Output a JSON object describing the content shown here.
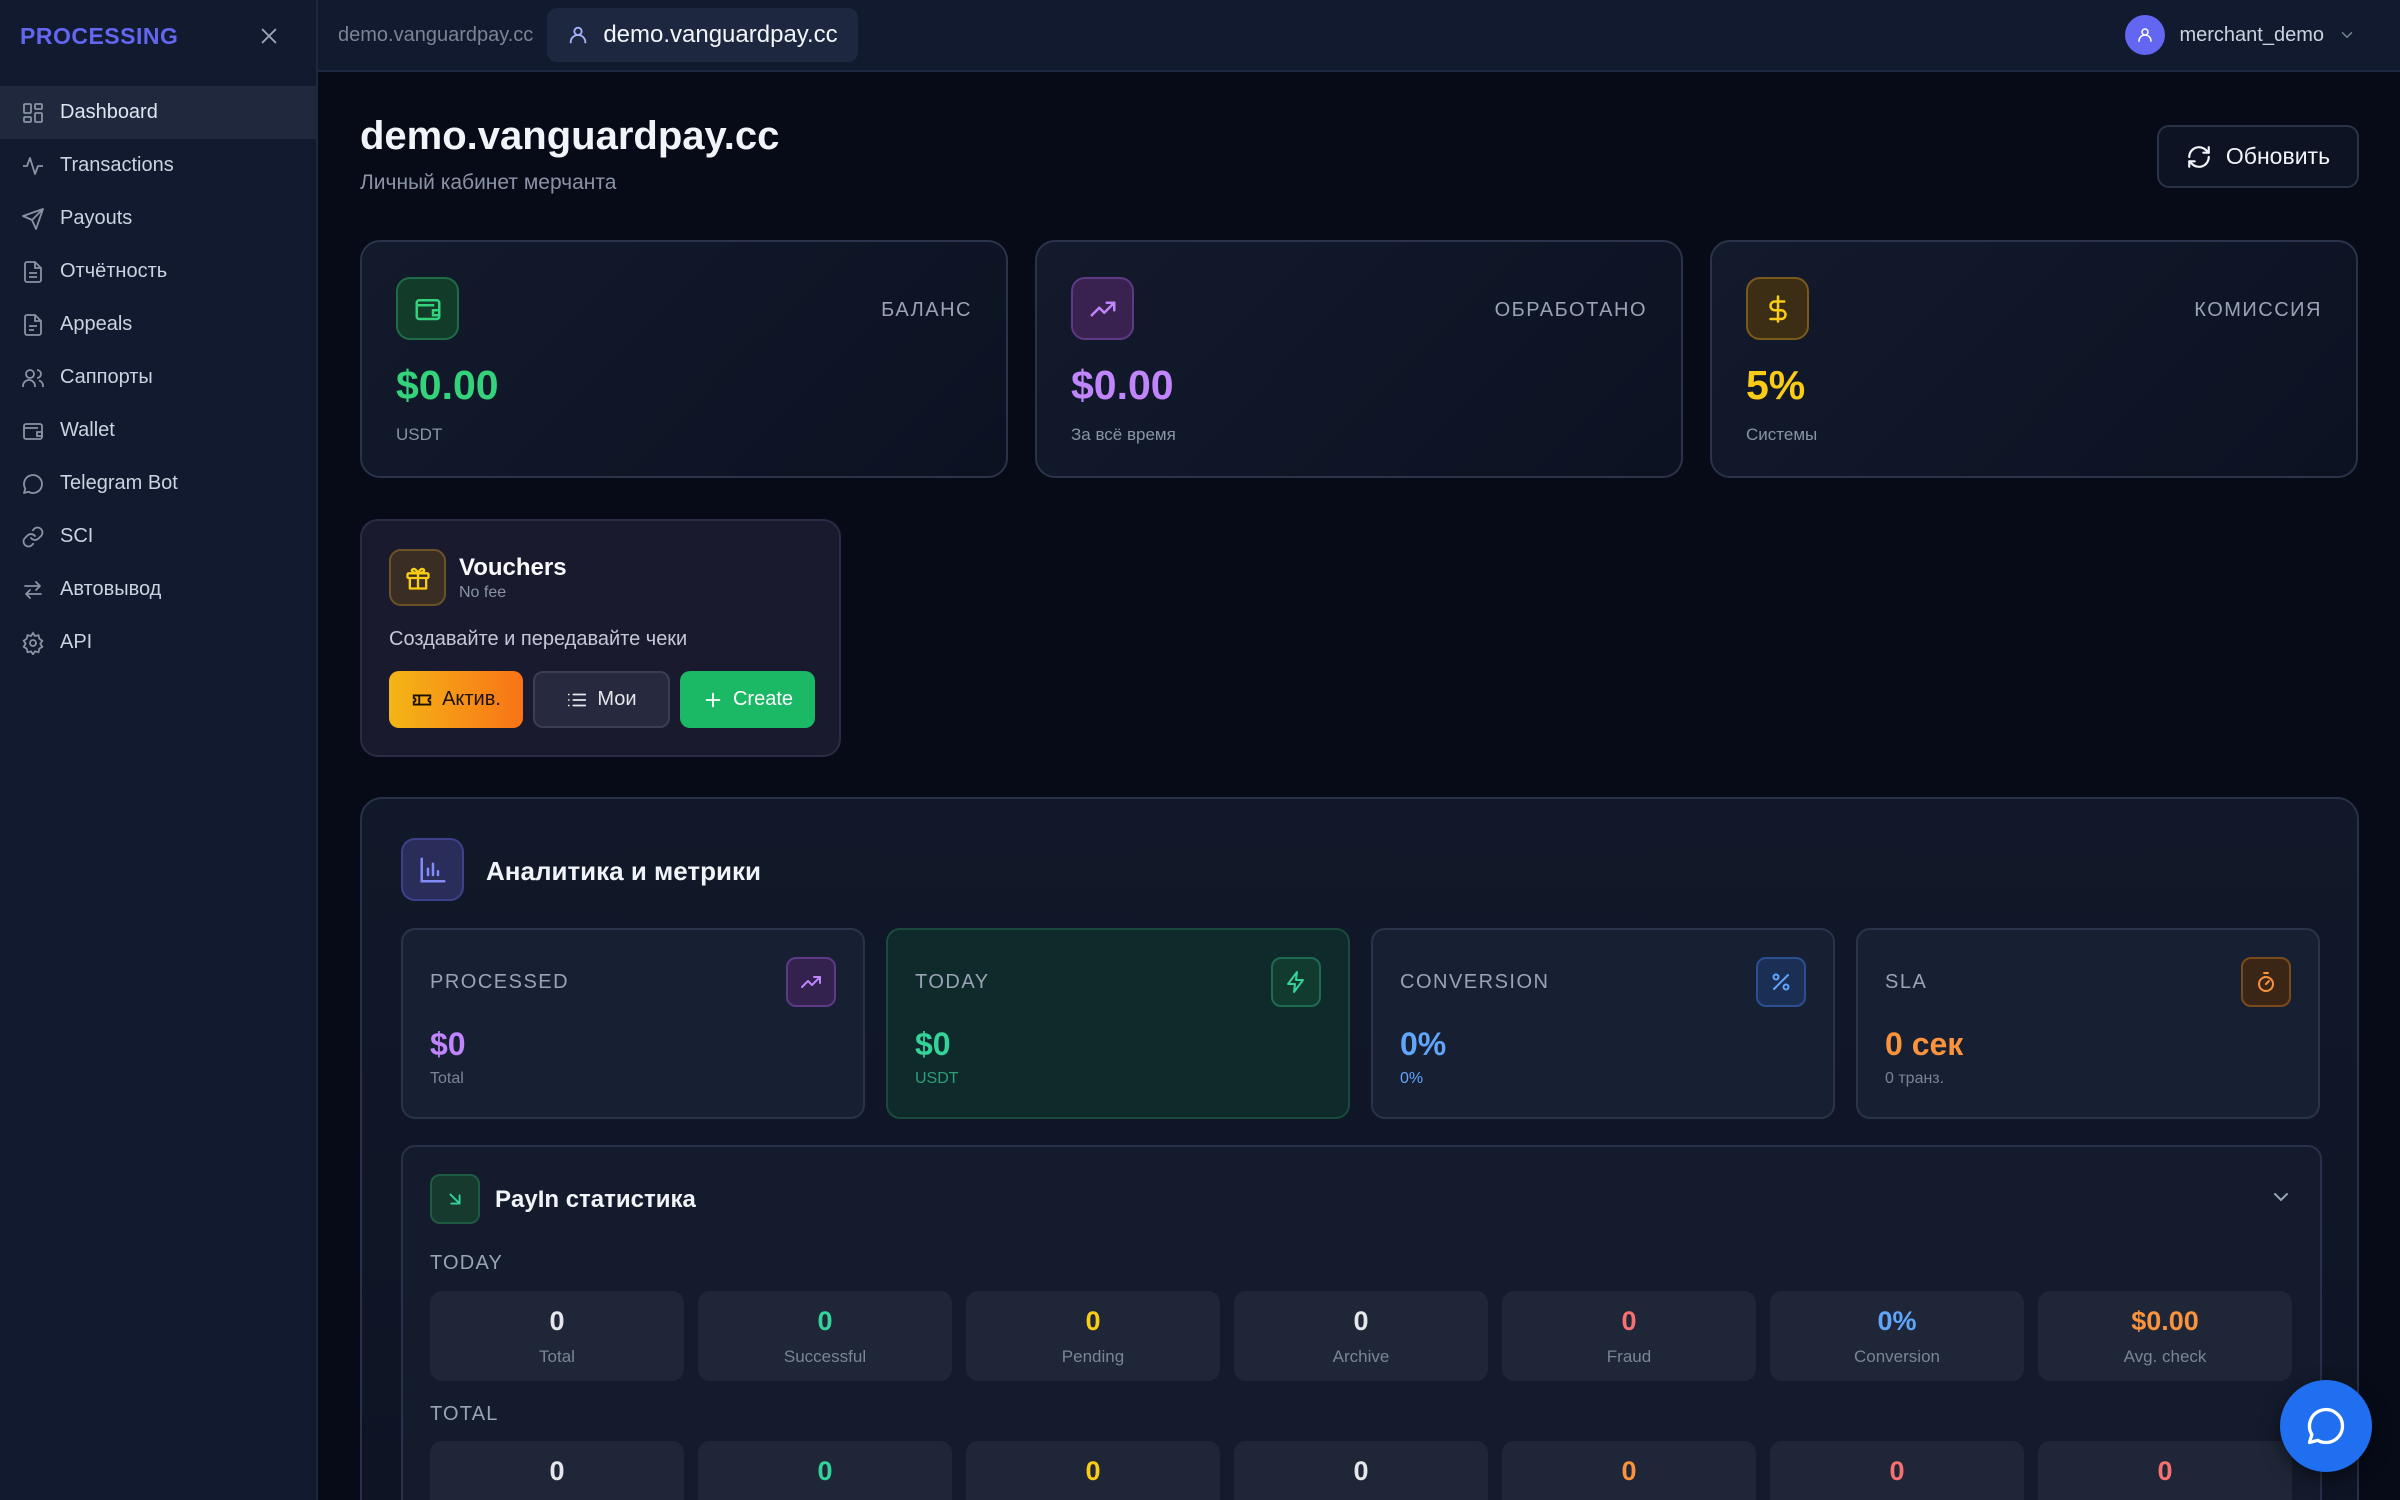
{
  "sidebar": {
    "brand": "PROCESSING",
    "items": [
      {
        "label": "Dashboard",
        "icon": "dashboard-icon"
      },
      {
        "label": "Transactions",
        "icon": "activity-icon"
      },
      {
        "label": "Payouts",
        "icon": "send-icon"
      },
      {
        "label": "Отчётность",
        "icon": "report-icon"
      },
      {
        "label": "Appeals",
        "icon": "document-icon"
      },
      {
        "label": "Саппорты",
        "icon": "users-icon"
      },
      {
        "label": "Wallet",
        "icon": "wallet-icon"
      },
      {
        "label": "Telegram Bot",
        "icon": "chat-icon"
      },
      {
        "label": "SCI",
        "icon": "link-icon"
      },
      {
        "label": "Автовывод",
        "icon": "transfer-icon"
      },
      {
        "label": "API",
        "icon": "gear-icon"
      }
    ]
  },
  "topbar": {
    "breadcrumb": "demo.vanguardpay.cc",
    "domain": "demo.vanguardpay.cc",
    "user": "merchant_demo"
  },
  "header": {
    "title": "demo.vanguardpay.cc",
    "subtitle": "Личный кабинет мерчанта",
    "refresh_label": "Обновить"
  },
  "stats": {
    "balance": {
      "label": "БАЛАНС",
      "value": "$0.00",
      "note": "USDT",
      "color": "#34d27a"
    },
    "processed": {
      "label": "ОБРАБОТАНО",
      "value": "$0.00",
      "note": "За всё время",
      "color": "#c084fc"
    },
    "commission": {
      "label": "КОМИССИЯ",
      "value": "5%",
      "note": "Системы",
      "color": "#facc15"
    }
  },
  "vouchers": {
    "title": "Vouchers",
    "subtitle": "No fee",
    "description": "Создавайте и передавайте чеки",
    "activate_label": "Актив.",
    "mine_label": "Мои",
    "create_label": "Create"
  },
  "analytics": {
    "title": "Аналитика и метрики",
    "metrics": {
      "processed": {
        "label": "PROCESSED",
        "value": "$0",
        "note": "Total"
      },
      "today": {
        "label": "TODAY",
        "value": "$0",
        "note": "USDT"
      },
      "conversion": {
        "label": "CONVERSION",
        "value": "0%",
        "note": "0%"
      },
      "sla": {
        "label": "SLA",
        "value": "0 сек",
        "note": "0 транз."
      }
    }
  },
  "payin": {
    "title": "PayIn статистика",
    "today_label": "TODAY",
    "total_label": "TOTAL",
    "today": [
      {
        "value": "0",
        "label": "Total"
      },
      {
        "value": "0",
        "label": "Successful"
      },
      {
        "value": "0",
        "label": "Pending"
      },
      {
        "value": "0",
        "label": "Archive"
      },
      {
        "value": "0",
        "label": "Fraud"
      },
      {
        "value": "0%",
        "label": "Conversion"
      },
      {
        "value": "$0.00",
        "label": "Avg. check"
      }
    ],
    "total": [
      {
        "value": "0"
      },
      {
        "value": "0"
      },
      {
        "value": "0"
      },
      {
        "value": "0"
      },
      {
        "value": "0"
      },
      {
        "value": "0"
      },
      {
        "value": "0"
      }
    ]
  }
}
